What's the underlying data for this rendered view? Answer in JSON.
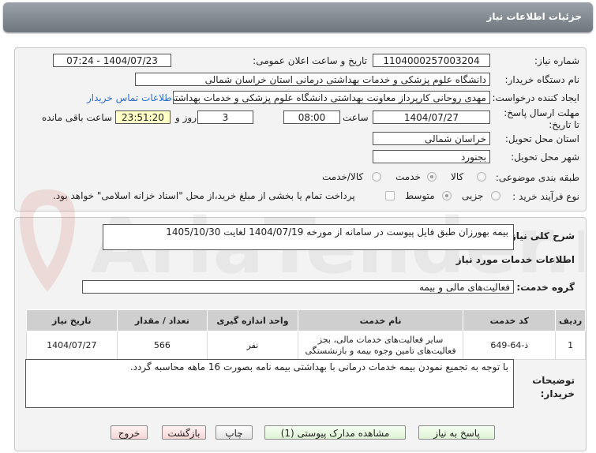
{
  "header": {
    "title": "جزئیات اطلاعات نیاز"
  },
  "form": {
    "need_number_label": "شماره نیاز:",
    "need_number": "1104000257003204",
    "announce_label": "تاریخ و ساعت اعلان عمومی:",
    "announce_value": "1404/07/23 - 07:24",
    "buyer_org_label": "نام دستگاه خریدار:",
    "buyer_org": "دانشگاه علوم پزشکی و خدمات بهداشتی درمانی استان خراسان شمالی",
    "creator_label": "ایجاد کننده درخواست:",
    "creator": "مهدی روحانی کارپرداز معاونت بهداشتی دانشگاه علوم پزشکی و خدمات بهداشتی",
    "contact_link": "اطلاعات تماس خریدار",
    "deadline_label": "مهلت ارسال پاسخ: تا تاریخ:",
    "deadline_date": "1404/07/27",
    "time_label": "ساعت",
    "deadline_time": "08:00",
    "days_value": "3",
    "days_label": "روز و",
    "remaining_time": "23:51:20",
    "remaining_label": "ساعت باقی مانده",
    "province_label": "استان محل تحویل:",
    "province": "خراسان شمالی",
    "city_label": "شهر محل تحویل:",
    "city": "بجنورد",
    "category_label": "طبقه بندی موضوعی:",
    "category_options": {
      "goods": "کالا",
      "service": "خدمت",
      "goods_service": "کالا/خدمت"
    },
    "process_label": "نوع فرآیند خرید :",
    "process_options": {
      "partial": "جزیی",
      "medium": "متوسط"
    },
    "payment_note": "پرداخت تمام یا بخشی از مبلغ خرید،از محل \"اسناد خزانه اسلامی\" خواهد بود."
  },
  "details": {
    "summary_label": "شرح کلی نیاز:",
    "summary": "بیمه بهورزان طبق فایل پیوست در سامانه  از مورخه 1404/07/19 لغایت 1405/10/30",
    "services_heading": "اطلاعات خدمات مورد نیاز",
    "service_group_label": "گروه خدمت:",
    "service_group": "فعالیت‌های مالی و بیمه",
    "table": {
      "headers": [
        "ردیف",
        "کد خدمت",
        "نام خدمت",
        "واحد اندازه گیری",
        "تعداد / مقدار",
        "تاریخ نیاز"
      ],
      "rows": [
        [
          "1",
          "ذ-64-649",
          "سایر فعالیت‌های خدمات مالی، بجز فعالیت‌های تامین وجوه بیمه و بازنشستگی",
          "نفر",
          "566",
          "1404/07/27"
        ]
      ]
    },
    "buyer_notes_label": "توضیحات خریدار:",
    "buyer_notes": "با توجه به تجمیع نمودن بیمه خدمات درمانی با بهداشتی بیمه نامه بصورت 16 ماهه محاسبه گردد."
  },
  "buttons": {
    "reply": "پاسخ به نیاز",
    "attachments": "مشاهده مدارک پیوستی (1)",
    "print": "چاپ",
    "back": "بازگشت",
    "exit": "خروج"
  },
  "watermark": {
    "text": "AriaTender.net"
  },
  "colors": {
    "link": "#2a6fc9",
    "header": "#7d848b",
    "remaining_bg": "#ffffc6"
  }
}
